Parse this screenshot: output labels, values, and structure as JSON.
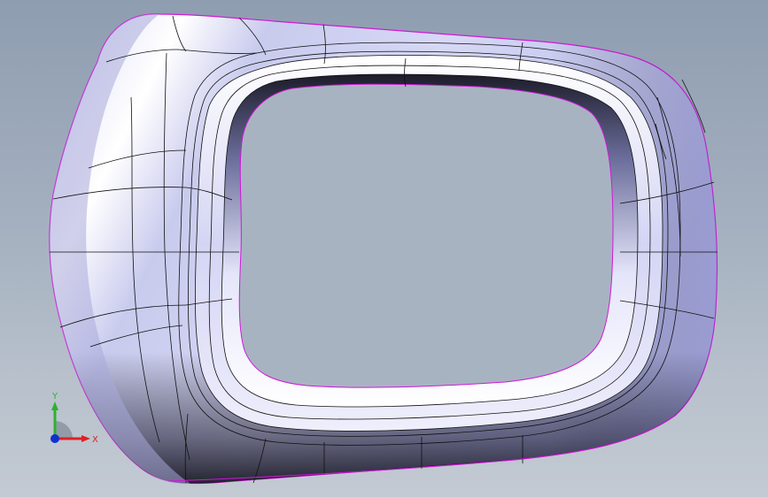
{
  "viewport": {
    "background_top": "#8f9db1",
    "background_bottom": "#c3cad3"
  },
  "model": {
    "surface_color": "#c6c8ee",
    "highlight_color": "#ffffff",
    "shadow_color": "#1a1a2a",
    "edge_color": "#111111",
    "silhouette_color": "#d018d8"
  },
  "triad": {
    "x_label": "X",
    "y_label": "Y",
    "x_color": "#e02020",
    "y_color": "#30b030",
    "z_color": "#1030d0"
  }
}
